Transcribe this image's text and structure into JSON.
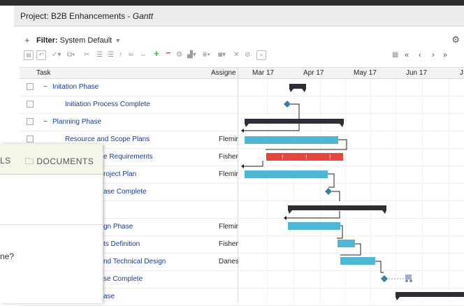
{
  "window": {
    "title_prefix": "Project: B2B Enhancements - ",
    "title_view": "Gantt"
  },
  "filter": {
    "label_bold": "Filter:",
    "value": "System Default"
  },
  "toolbar": {
    "expand_all": "»"
  },
  "columns": {
    "task": "Task",
    "assignee": "Assigne"
  },
  "timeline": {
    "months": [
      "Mar 17",
      "Apr 17",
      "May 17",
      "Jun 17",
      "J"
    ]
  },
  "tasks": [
    {
      "name": "Initation Phase",
      "assignee": "",
      "indent": 1,
      "collapsible": true
    },
    {
      "name": "Initiation Process Complete",
      "assignee": "",
      "indent": 2
    },
    {
      "name": "Planning Phase",
      "assignee": "",
      "indent": 1,
      "collapsible": true
    },
    {
      "name": "Resource and Scope Plans",
      "assignee": "Flemir",
      "indent": 2
    },
    {
      "name": "e Requirements",
      "assignee": "Fisher",
      "indent": 2
    },
    {
      "name": "roject Plan",
      "assignee": "Flemir",
      "indent": 2
    },
    {
      "name": "ase Complete",
      "assignee": "",
      "indent": 2
    },
    {
      "name": "",
      "assignee": "",
      "indent": 2
    },
    {
      "name": "gn Phase",
      "assignee": "Flemir",
      "indent": 2
    },
    {
      "name": "ts Definition",
      "assignee": "Fisher",
      "indent": 2
    },
    {
      "name": "nd Technical Design",
      "assignee": "Danes",
      "indent": 2
    },
    {
      "name": "se Complete",
      "assignee": "",
      "indent": 2
    },
    {
      "name": "ase",
      "assignee": "",
      "indent": 2
    }
  ],
  "side_panel": {
    "tab_partial": "LS",
    "tab_documents": "DOCUMENTS",
    "question_partial": "ne?"
  },
  "colors": {
    "summary": "#2b2f33",
    "task": "#4fb6d3",
    "critical": "#e8453c",
    "milestone": "#3a7ea3"
  }
}
